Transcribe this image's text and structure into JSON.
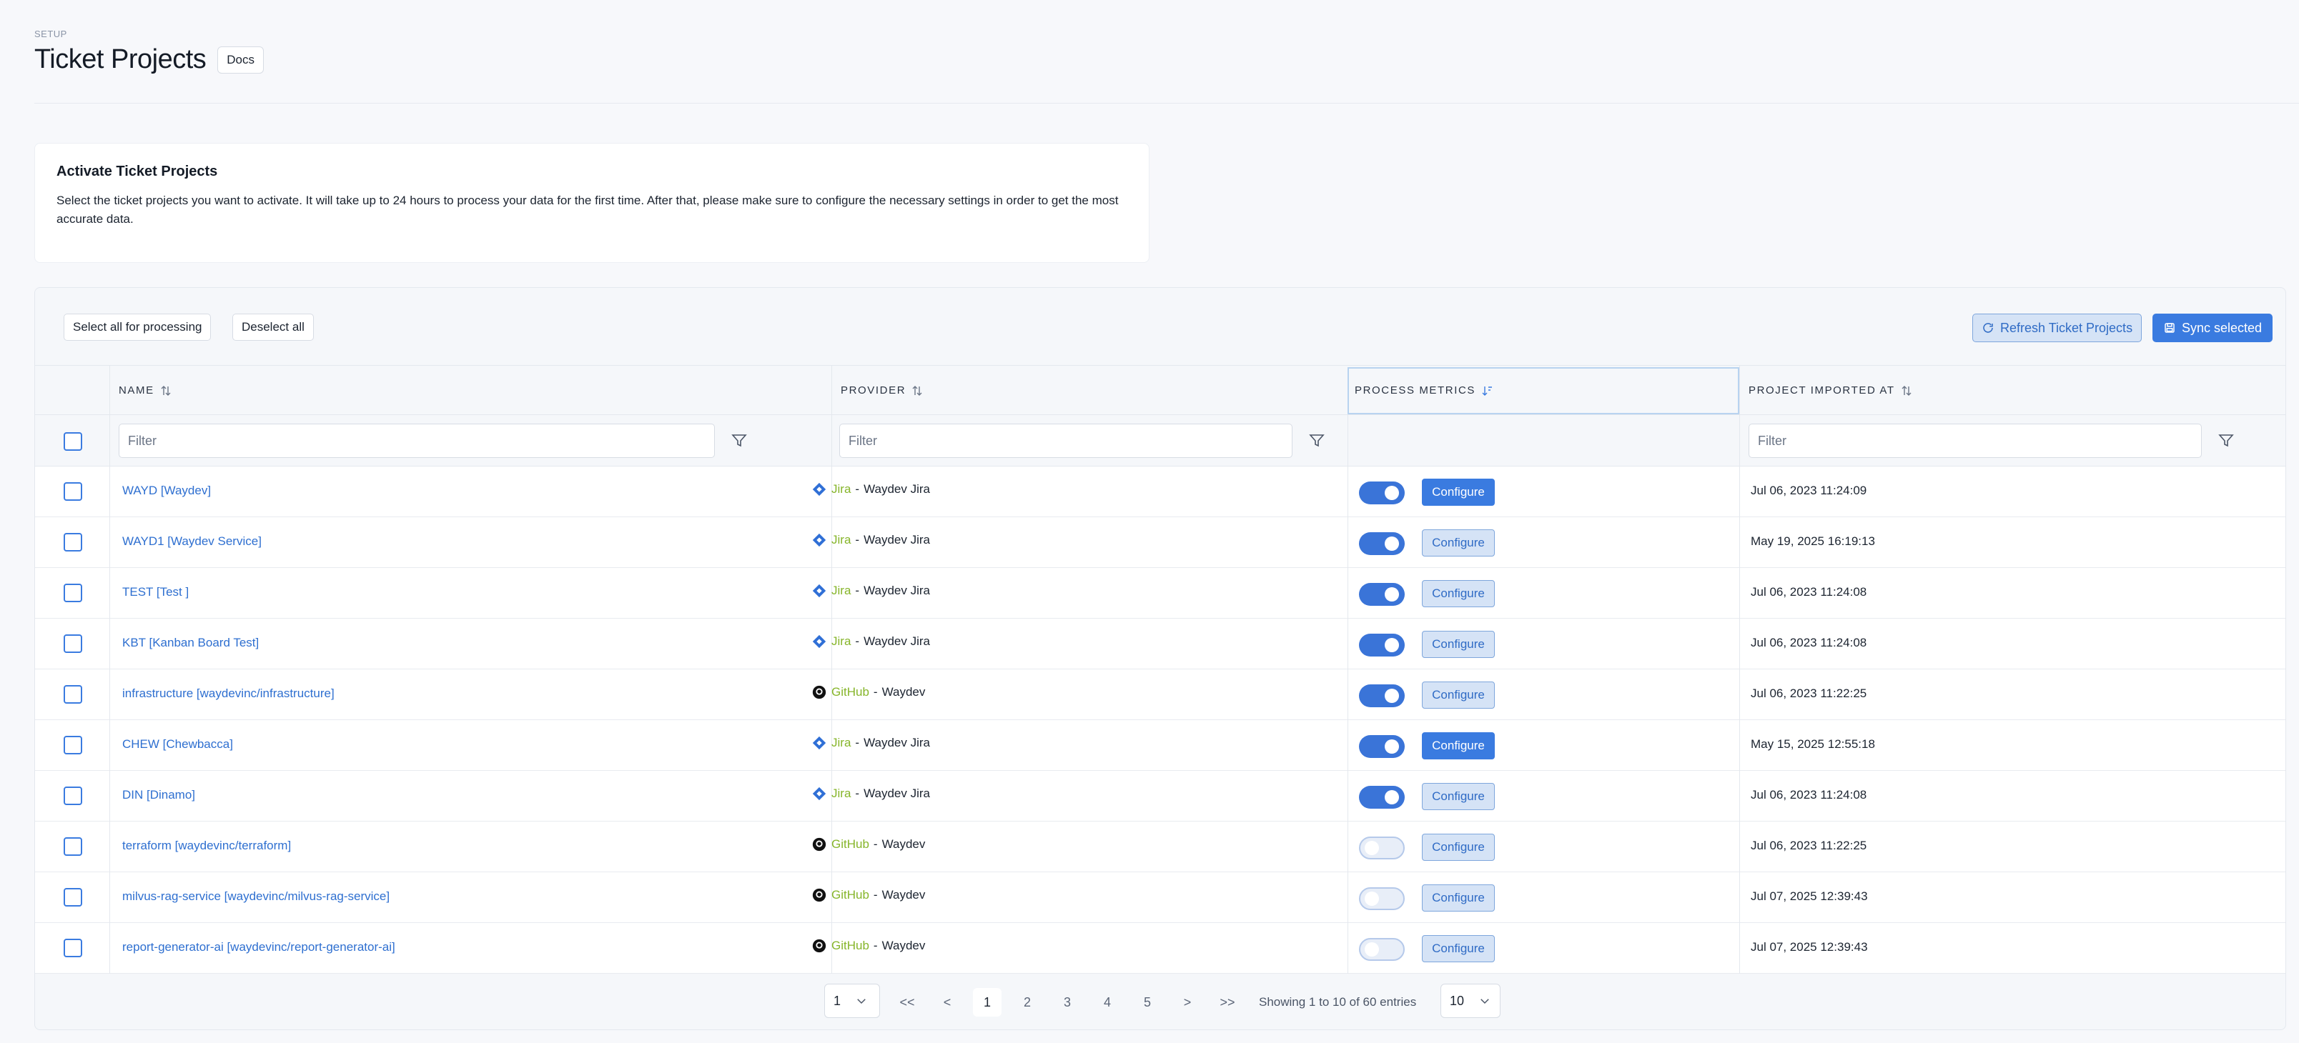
{
  "header": {
    "eyebrow": "SETUP",
    "title": "Ticket Projects",
    "docs_label": "Docs"
  },
  "info": {
    "title": "Activate Ticket Projects",
    "text": "Select the ticket projects you want to activate. It will take up to 24 hours to process your data for the first time. After that, please make sure to configure the necessary settings in order to get the most accurate data."
  },
  "toolbar": {
    "select_all": "Select all for processing",
    "deselect_all": "Deselect all",
    "refresh": "Refresh Ticket Projects",
    "sync": "Sync selected"
  },
  "columns": {
    "name": "NAME",
    "provider": "PROVIDER",
    "process_metrics": "PROCESS METRICS",
    "imported_at": "PROJECT IMPORTED AT"
  },
  "filters": {
    "name_placeholder": "Filter",
    "provider_placeholder": "Filter",
    "imported_placeholder": "Filter"
  },
  "rows": [
    {
      "name": "WAYD [Waydev]",
      "provider_type": "Jira",
      "provider_name": "Waydev Jira",
      "icon": "jira-icon",
      "enabled": true,
      "configure_style": "solid",
      "configure": "Configure",
      "imported": "Jul 06, 2023 11:24:09"
    },
    {
      "name": "WAYD1 [Waydev Service]",
      "provider_type": "Jira",
      "provider_name": "Waydev Jira",
      "icon": "jira-icon",
      "enabled": true,
      "configure_style": "ghost",
      "configure": "Configure",
      "imported": "May 19, 2025 16:19:13"
    },
    {
      "name": "TEST [Test ]",
      "provider_type": "Jira",
      "provider_name": "Waydev Jira",
      "icon": "jira-icon",
      "enabled": true,
      "configure_style": "ghost",
      "configure": "Configure",
      "imported": "Jul 06, 2023 11:24:08"
    },
    {
      "name": "KBT [Kanban Board Test]",
      "provider_type": "Jira",
      "provider_name": "Waydev Jira",
      "icon": "jira-icon",
      "enabled": true,
      "configure_style": "ghost",
      "configure": "Configure",
      "imported": "Jul 06, 2023 11:24:08"
    },
    {
      "name": "infrastructure [waydevinc/infrastructure]",
      "provider_type": "GitHub",
      "provider_name": "Waydev",
      "icon": "github-icon",
      "enabled": true,
      "configure_style": "ghost",
      "configure": "Configure",
      "imported": "Jul 06, 2023 11:22:25"
    },
    {
      "name": "CHEW [Chewbacca]",
      "provider_type": "Jira",
      "provider_name": "Waydev Jira",
      "icon": "jira-icon",
      "enabled": true,
      "configure_style": "solid",
      "configure": "Configure",
      "imported": "May 15, 2025 12:55:18"
    },
    {
      "name": "DIN [Dinamo]",
      "provider_type": "Jira",
      "provider_name": "Waydev Jira",
      "icon": "jira-icon",
      "enabled": true,
      "configure_style": "ghost",
      "configure": "Configure",
      "imported": "Jul 06, 2023 11:24:08"
    },
    {
      "name": "terraform [waydevinc/terraform]",
      "provider_type": "GitHub",
      "provider_name": "Waydev",
      "icon": "github-icon",
      "enabled": false,
      "configure_style": "ghost",
      "configure": "Configure",
      "imported": "Jul 06, 2023 11:22:25"
    },
    {
      "name": "milvus-rag-service [waydevinc/milvus-rag-service]",
      "provider_type": "GitHub",
      "provider_name": "Waydev",
      "icon": "github-icon",
      "enabled": false,
      "configure_style": "ghost",
      "configure": "Configure",
      "imported": "Jul 07, 2025 12:39:43"
    },
    {
      "name": "report-generator-ai [waydevinc/report-generator-ai]",
      "provider_type": "GitHub",
      "provider_name": "Waydev",
      "icon": "github-icon",
      "enabled": false,
      "configure_style": "ghost",
      "configure": "Configure",
      "imported": "Jul 07, 2025 12:39:43"
    }
  ],
  "pagination": {
    "page_select": "1",
    "first": "<<",
    "prev": "<",
    "pages": [
      "1",
      "2",
      "3",
      "4",
      "5"
    ],
    "current": "1",
    "next": ">",
    "last": ">>",
    "info": "Showing 1 to 10 of 60 entries",
    "page_size": "10"
  },
  "colors": {
    "accent": "#3a7be0",
    "link": "#2e6fd0",
    "provider_type": "#86b52a"
  }
}
